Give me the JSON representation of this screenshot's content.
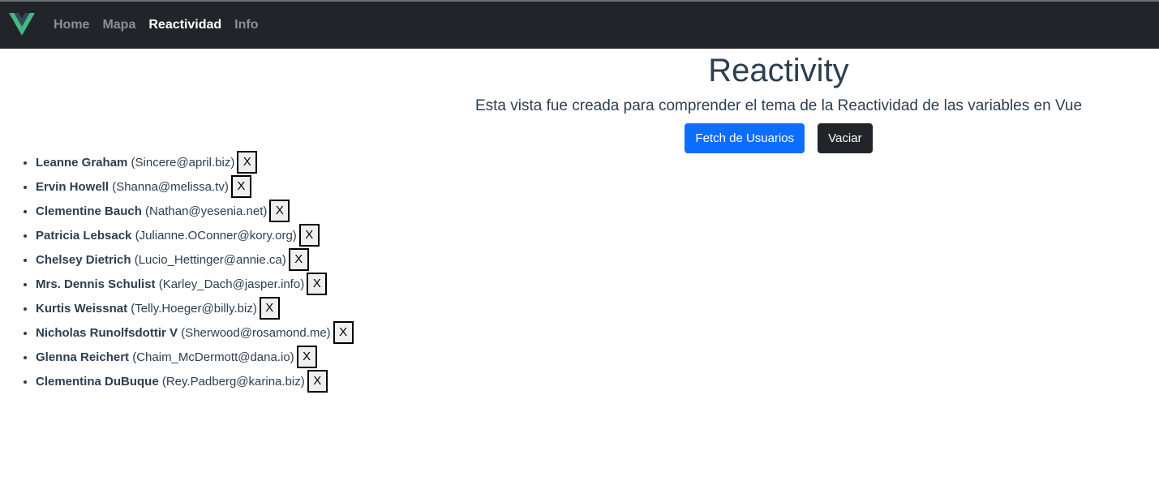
{
  "nav": {
    "logo_icon": "vue-logo-icon",
    "items": [
      {
        "label": "Home",
        "active": false
      },
      {
        "label": "Mapa",
        "active": false
      },
      {
        "label": "Reactividad",
        "active": true
      },
      {
        "label": "Info",
        "active": false
      }
    ]
  },
  "hero": {
    "title": "Reactivity",
    "subtitle": "Esta vista fue creada para comprender el tema de la Reactividad de las variables en Vue",
    "fetch_label": "Fetch de Usuarios",
    "clear_label": "Vaciar"
  },
  "users": [
    {
      "name": "Leanne Graham",
      "email": "(Sincere@april.biz)",
      "delete_label": "X"
    },
    {
      "name": "Ervin Howell",
      "email": "(Shanna@melissa.tv)",
      "delete_label": "X"
    },
    {
      "name": "Clementine Bauch",
      "email": "(Nathan@yesenia.net)",
      "delete_label": "X"
    },
    {
      "name": "Patricia Lebsack",
      "email": "(Julianne.OConner@kory.org)",
      "delete_label": "X"
    },
    {
      "name": "Chelsey Dietrich",
      "email": "(Lucio_Hettinger@annie.ca)",
      "delete_label": "X"
    },
    {
      "name": "Mrs. Dennis Schulist",
      "email": "(Karley_Dach@jasper.info)",
      "delete_label": "X"
    },
    {
      "name": "Kurtis Weissnat",
      "email": "(Telly.Hoeger@billy.biz)",
      "delete_label": "X"
    },
    {
      "name": "Nicholas Runolfsdottir V",
      "email": "(Sherwood@rosamond.me)",
      "delete_label": "X"
    },
    {
      "name": "Glenna Reichert",
      "email": "(Chaim_McDermott@dana.io)",
      "delete_label": "X"
    },
    {
      "name": "Clementina DuBuque",
      "email": "(Rey.Padberg@karina.biz)",
      "delete_label": "X"
    }
  ],
  "colors": {
    "navbar_bg": "#212529",
    "primary": "#0d6efd",
    "dark": "#212529",
    "text": "#2c3e50",
    "vue_green": "#42b883",
    "vue_dark": "#35495e"
  }
}
